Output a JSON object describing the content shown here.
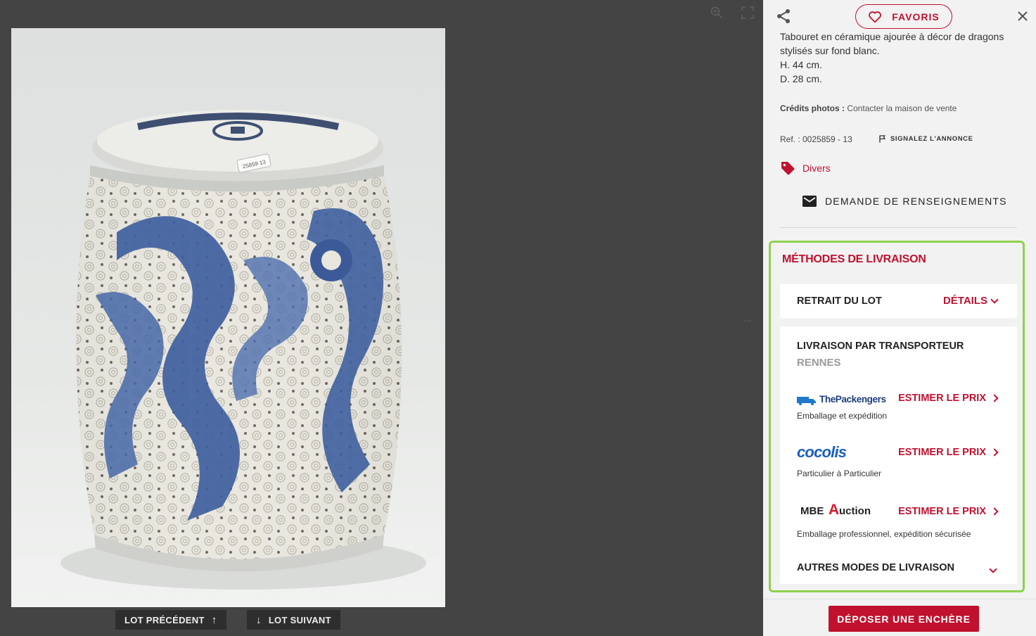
{
  "viewer": {
    "photo_label": "Tabouret en céramique ajourée à décor de dragons",
    "sticker": "25859 13",
    "prev_label": "LOT PRÉCÉDENT",
    "next_label": "LOT SUIVANT"
  },
  "header": {
    "favorites_label": "FAVORIS"
  },
  "description": {
    "lines": [
      "Tabouret en céramique ajourée à décor de dragons",
      "stylisés sur fond blanc.",
      "H. 44 cm.",
      "D. 28 cm."
    ]
  },
  "credits": {
    "label": "Crédits photos :",
    "value": "Contacter la maison de vente"
  },
  "reference": {
    "text": "Ref. : 0025859 - 13",
    "report_label": "SIGNALEZ L'ANNONCE"
  },
  "category": {
    "label": "Divers"
  },
  "inquiry": {
    "label": "DEMANDE DE RENSEIGNEMENTS"
  },
  "shipping": {
    "title": "MÉTHODES DE LIVRAISON",
    "pickup_label": "RETRAIT DU LOT",
    "details_label": "DÉTAILS",
    "carrier_title": "LIVRAISON PAR TRANSPORTEUR",
    "city": "RENNES",
    "providers": [
      {
        "logo_text": "ThePackengers",
        "estimate_label": "ESTIMER LE PRIX",
        "subtitle": "Emballage et expédition"
      },
      {
        "logo_text": "cocolis",
        "estimate_label": "ESTIMER LE PRIX",
        "subtitle": "Particulier à Particulier"
      },
      {
        "logo_text_1": "MBE",
        "logo_text_2": "A",
        "logo_text_3": "uction",
        "estimate_label": "ESTIMER LE PRIX",
        "subtitle": "Emballage professionnel, expédition sécurisée"
      }
    ],
    "other_label": "AUTRES MODES DE LIVRAISON"
  },
  "bid": {
    "label": "DÉPOSER UNE ENCHÈRE"
  },
  "colors": {
    "accent": "#c0112f",
    "highlight_border": "#8fd14f",
    "viewer_bg": "#444444",
    "panel_bg": "#f2f2f2"
  }
}
